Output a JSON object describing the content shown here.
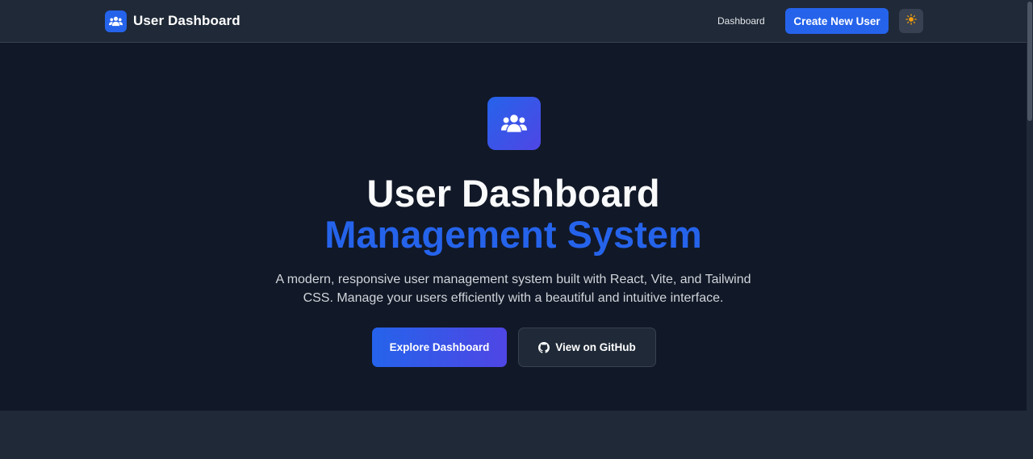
{
  "navbar": {
    "brand_title": "User Dashboard",
    "brand_icon": "users-icon",
    "links": {
      "dashboard": "Dashboard"
    },
    "create_button": "Create New User",
    "theme_toggle_icon": "sun-icon"
  },
  "hero": {
    "icon": "users-icon",
    "title_line_1": "User Dashboard",
    "title_line_2": "Management System",
    "description": "A modern, responsive user management system built with React, Vite, and Tailwind CSS. Manage your users efficiently with a beautiful and intuitive interface.",
    "primary_button": "Explore Dashboard",
    "secondary_button": "View on GitHub",
    "secondary_button_icon": "github-icon"
  },
  "colors": {
    "accent": "#2563eb",
    "accent_gradient_end": "#4f46e5",
    "navbar_bg": "#1f2937",
    "hero_bg": "#111827",
    "sun": "#f59e0b"
  }
}
